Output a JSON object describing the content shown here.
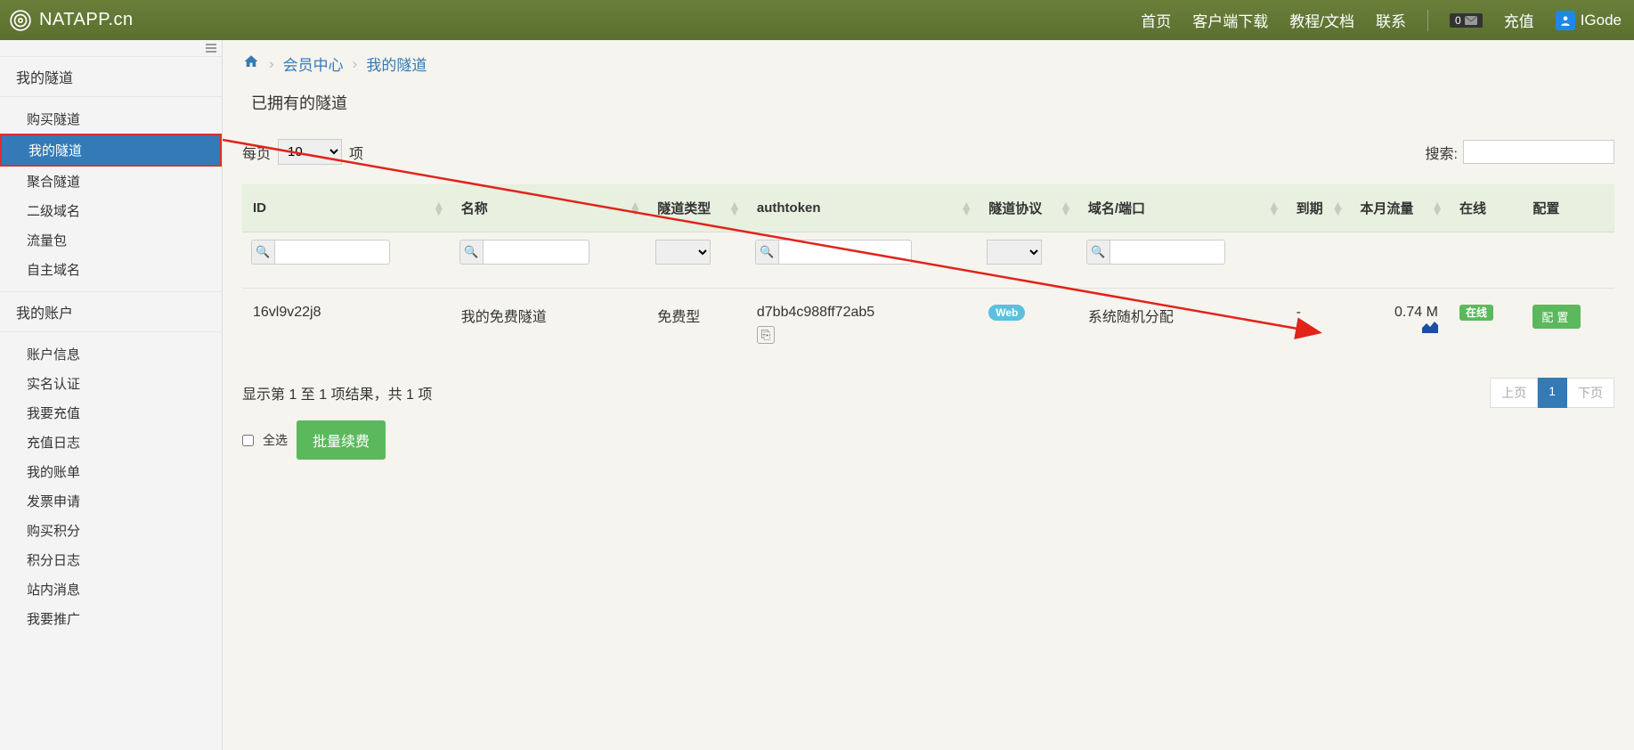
{
  "header": {
    "brand": "NATAPP.cn",
    "nav": [
      "首页",
      "客户端下载",
      "教程/文档",
      "联系"
    ],
    "msg_count": "0",
    "recharge": "充值",
    "user": "IGode"
  },
  "sidebar": {
    "group1_title": "我的隧道",
    "group1_items": [
      "购买隧道",
      "我的隧道",
      "聚合隧道",
      "二级域名",
      "流量包",
      "自主域名"
    ],
    "group1_active_index": 1,
    "group2_title": "我的账户",
    "group2_items": [
      "账户信息",
      "实名认证",
      "我要充值",
      "充值日志",
      "我的账单",
      "发票申请",
      "购买积分",
      "积分日志",
      "站内消息",
      "我要推广"
    ]
  },
  "breadcrumb": {
    "member_center": "会员中心",
    "current": "我的隧道"
  },
  "section_title": "已拥有的隧道",
  "page_len": {
    "prefix": "每页",
    "value": "10",
    "suffix": "项"
  },
  "search": {
    "label": "搜索:"
  },
  "columns": [
    "ID",
    "名称",
    "隧道类型",
    "authtoken",
    "隧道协议",
    "域名/端口",
    "到期",
    "本月流量",
    "在线",
    "配置"
  ],
  "row": {
    "id": "16vl9v22j8",
    "name": "我的免费隧道",
    "type": "免费型",
    "authtoken": "d7bb4c988ff72ab5",
    "protocol": "Web",
    "domain": "系统随机分配",
    "expire": "-",
    "traffic": "0.74 M",
    "online": "在线",
    "config": "配置"
  },
  "info_text": "显示第 1 至 1 项结果，共 1 项",
  "paginate": {
    "prev": "上页",
    "page": "1",
    "next": "下页"
  },
  "bulk": {
    "select_all": "全选",
    "renew": "批量续费"
  }
}
